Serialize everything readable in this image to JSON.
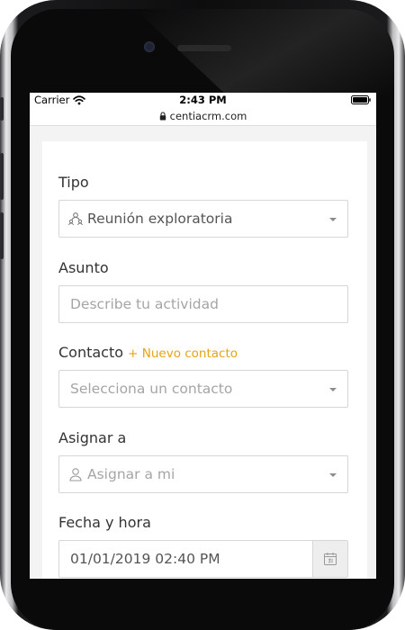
{
  "status_bar": {
    "carrier": "Carrier",
    "time": "2:43 PM"
  },
  "browser": {
    "url": "centiacrm.com"
  },
  "form": {
    "tipo": {
      "label": "Tipo",
      "value": "Reunión exploratoria",
      "icon": "meeting-icon"
    },
    "asunto": {
      "label": "Asunto",
      "placeholder": "Describe tu actividad"
    },
    "contacto": {
      "label": "Contacto",
      "add_link": "+ Nuevo contacto",
      "placeholder": "Selecciona un contacto"
    },
    "asignar": {
      "label": "Asignar a",
      "value": "Asignar a mi",
      "icon": "user-icon"
    },
    "fecha": {
      "label": "Fecha y hora",
      "value": "01/01/2019 02:40 PM",
      "icon": "calendar-icon"
    }
  },
  "colors": {
    "accent": "#e6a314",
    "border": "#d6d6d6",
    "label": "#333333",
    "placeholder": "#a5a5a5",
    "page_bg": "#f3f3f3"
  }
}
